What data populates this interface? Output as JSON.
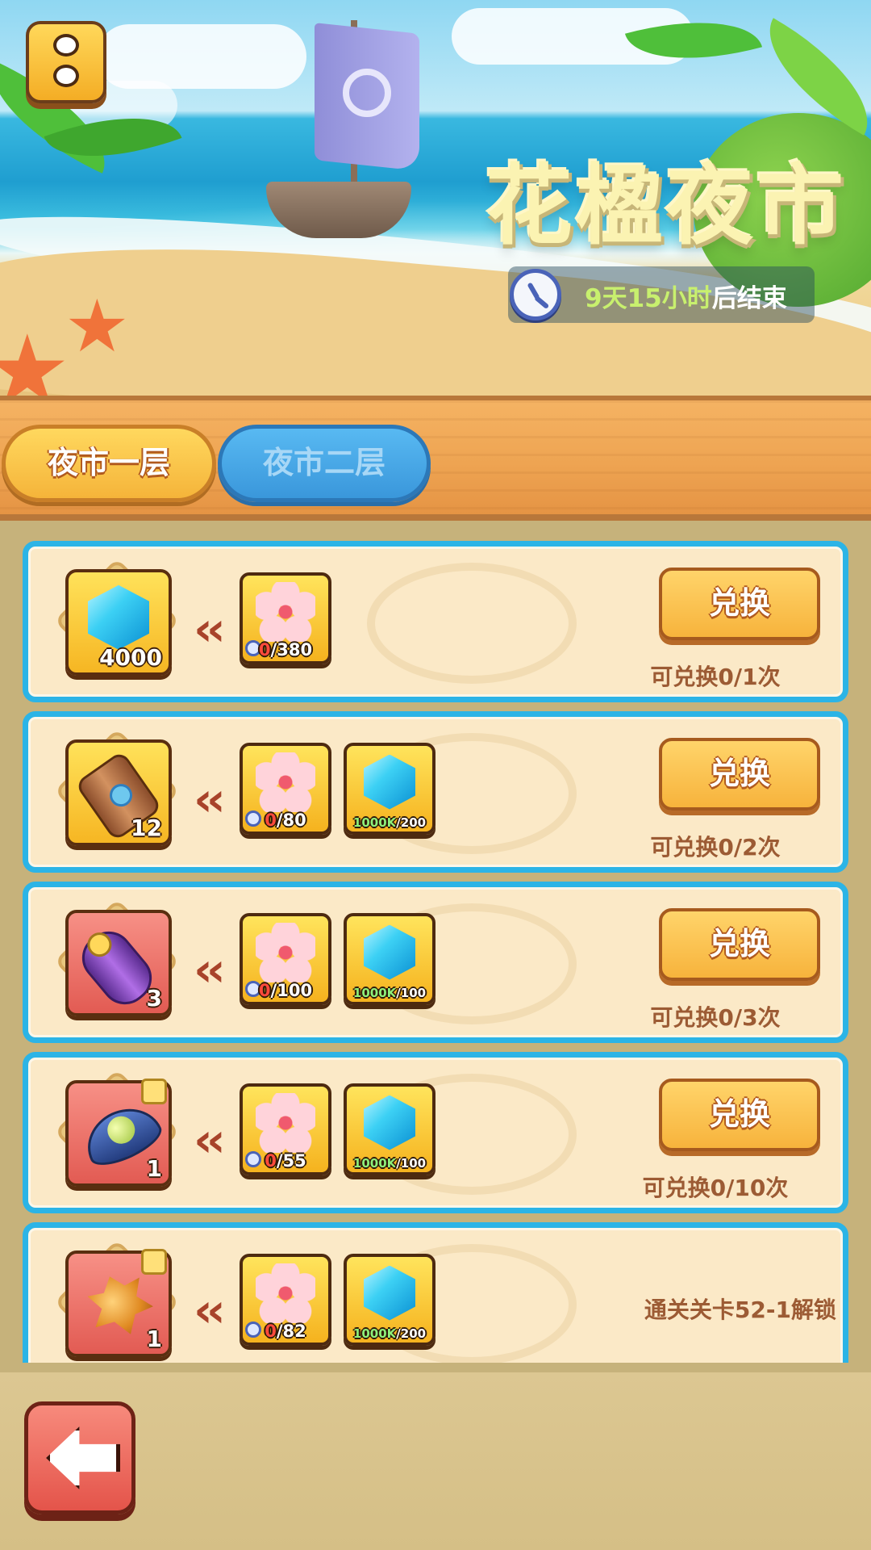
{
  "header": {
    "title": "花楹夜市",
    "timer": {
      "highlight": "9天15小时",
      "suffix": "后结束"
    }
  },
  "tabs": [
    {
      "label": "夜市一层",
      "active": true
    },
    {
      "label": "夜市二层",
      "active": false
    }
  ],
  "colors": {
    "card_border": "#2cb4e6",
    "card_bg": "#fbe9c7",
    "button_gold": "#f7b33c",
    "text_brown": "#9c5b34"
  },
  "items": [
    {
      "reward_icon": "gem-icon",
      "reward_qty": "4000",
      "costs": [
        {
          "icon": "blossom-icon",
          "current": "0",
          "required": "/380"
        }
      ],
      "button_label": "兑换",
      "limit": "可兑换0/1次"
    },
    {
      "reward_icon": "scroll-icon",
      "reward_qty": "12",
      "costs": [
        {
          "icon": "blossom-icon",
          "current": "0",
          "required": "/80"
        },
        {
          "icon": "gem-icon",
          "current": "1000K",
          "required": "/200"
        }
      ],
      "button_label": "兑换",
      "limit": "可兑换0/2次"
    },
    {
      "reward_icon": "purple-scroll-icon",
      "reward_qty": "3",
      "costs": [
        {
          "icon": "blossom-icon",
          "current": "0",
          "required": "/100"
        },
        {
          "icon": "gem-icon",
          "current": "1000K",
          "required": "/100"
        }
      ],
      "button_label": "兑换",
      "limit": "可兑换0/3次"
    },
    {
      "reward_icon": "seed-pod-icon",
      "reward_qty": "1",
      "costs": [
        {
          "icon": "blossom-icon",
          "current": "0",
          "required": "/55"
        },
        {
          "icon": "gem-icon",
          "current": "1000K",
          "required": "/100"
        }
      ],
      "button_label": "兑换",
      "limit": "可兑换0/10次"
    },
    {
      "reward_icon": "amber-leaf-icon",
      "reward_qty": "1",
      "costs": [
        {
          "icon": "blossom-icon",
          "current": "0",
          "required": "/82"
        },
        {
          "icon": "gem-icon",
          "current": "1000K",
          "required": "/200"
        }
      ],
      "locked_text": "通关关卡52-1解锁"
    }
  ]
}
